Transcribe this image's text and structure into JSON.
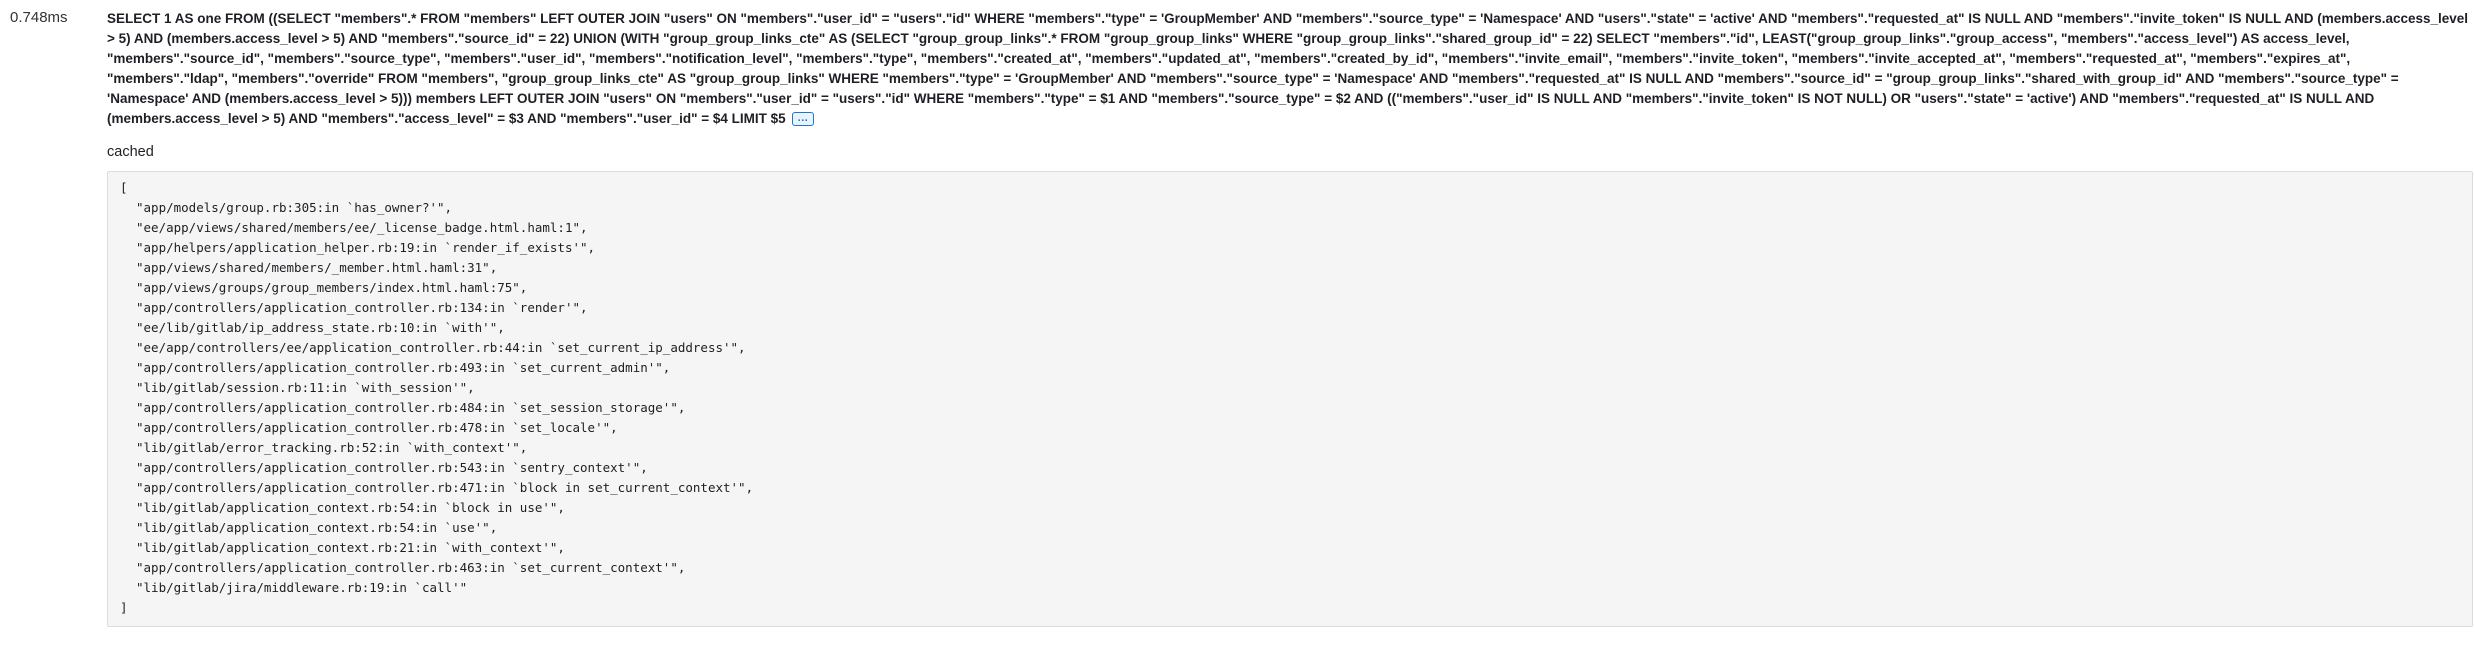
{
  "query": {
    "duration": "0.748ms",
    "sql": "SELECT 1 AS one FROM ((SELECT \"members\".* FROM \"members\" LEFT OUTER JOIN \"users\" ON \"members\".\"user_id\" = \"users\".\"id\" WHERE \"members\".\"type\" = 'GroupMember' AND \"members\".\"source_type\" = 'Namespace' AND \"users\".\"state\" = 'active' AND \"members\".\"requested_at\" IS NULL AND \"members\".\"invite_token\" IS NULL AND (members.access_level > 5) AND (members.access_level > 5) AND \"members\".\"source_id\" = 22) UNION (WITH \"group_group_links_cte\" AS (SELECT \"group_group_links\".* FROM \"group_group_links\" WHERE \"group_group_links\".\"shared_group_id\" = 22) SELECT \"members\".\"id\", LEAST(\"group_group_links\".\"group_access\", \"members\".\"access_level\") AS access_level, \"members\".\"source_id\", \"members\".\"source_type\", \"members\".\"user_id\", \"members\".\"notification_level\", \"members\".\"type\", \"members\".\"created_at\", \"members\".\"updated_at\", \"members\".\"created_by_id\", \"members\".\"invite_email\", \"members\".\"invite_token\", \"members\".\"invite_accepted_at\", \"members\".\"requested_at\", \"members\".\"expires_at\", \"members\".\"ldap\", \"members\".\"override\" FROM \"members\", \"group_group_links_cte\" AS \"group_group_links\" WHERE \"members\".\"type\" = 'GroupMember' AND \"members\".\"source_type\" = 'Namespace' AND \"members\".\"requested_at\" IS NULL AND \"members\".\"source_id\" = \"group_group_links\".\"shared_with_group_id\" AND \"members\".\"source_type\" = 'Namespace' AND (members.access_level > 5))) members LEFT OUTER JOIN \"users\" ON \"members\".\"user_id\" = \"users\".\"id\" WHERE \"members\".\"type\" = $1 AND \"members\".\"source_type\" = $2 AND ((\"members\".\"user_id\" IS NULL AND \"members\".\"invite_token\" IS NOT NULL) OR \"users\".\"state\" = 'active') AND \"members\".\"requested_at\" IS NULL AND (members.access_level > 5) AND \"members\".\"access_level\" = $3 AND \"members\".\"user_id\" = $4 LIMIT $5",
    "expand_label": "…",
    "cached_label": "cached",
    "backtrace_open": "[",
    "backtrace_close": "]",
    "backtrace": [
      "\"app/models/group.rb:305:in `has_owner?'\",",
      "\"ee/app/views/shared/members/ee/_license_badge.html.haml:1\",",
      "\"app/helpers/application_helper.rb:19:in `render_if_exists'\",",
      "\"app/views/shared/members/_member.html.haml:31\",",
      "\"app/views/groups/group_members/index.html.haml:75\",",
      "\"app/controllers/application_controller.rb:134:in `render'\",",
      "\"ee/lib/gitlab/ip_address_state.rb:10:in `with'\",",
      "\"ee/app/controllers/ee/application_controller.rb:44:in `set_current_ip_address'\",",
      "\"app/controllers/application_controller.rb:493:in `set_current_admin'\",",
      "\"lib/gitlab/session.rb:11:in `with_session'\",",
      "\"app/controllers/application_controller.rb:484:in `set_session_storage'\",",
      "\"app/controllers/application_controller.rb:478:in `set_locale'\",",
      "\"lib/gitlab/error_tracking.rb:52:in `with_context'\",",
      "\"app/controllers/application_controller.rb:543:in `sentry_context'\",",
      "\"app/controllers/application_controller.rb:471:in `block in set_current_context'\",",
      "\"lib/gitlab/application_context.rb:54:in `block in use'\",",
      "\"lib/gitlab/application_context.rb:54:in `use'\",",
      "\"lib/gitlab/application_context.rb:21:in `with_context'\",",
      "\"app/controllers/application_controller.rb:463:in `set_current_context'\",",
      "\"lib/gitlab/jira/middleware.rb:19:in `call'\""
    ]
  }
}
